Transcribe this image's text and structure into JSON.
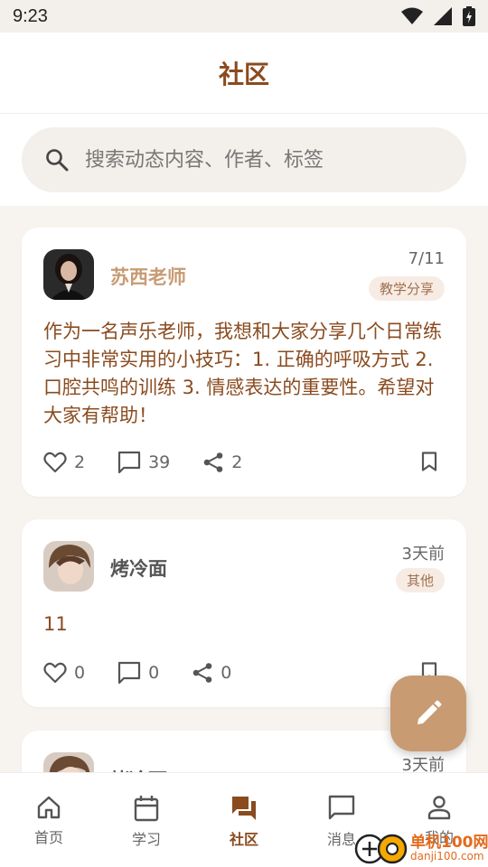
{
  "status_bar": {
    "time": "9:23"
  },
  "header": {
    "title": "社区"
  },
  "search": {
    "placeholder": "搜索动态内容、作者、标签"
  },
  "posts": [
    {
      "author": "苏西老师",
      "author_color": "#c89b73",
      "date": "7/11",
      "tag": "教学分享",
      "content": "作为一名声乐老师，我想和大家分享几个日常练习中非常实用的小技巧：1. 正确的呼吸方式 2. 口腔共鸣的训练 3. 情感表达的重要性。希望对大家有帮助！",
      "likes": "2",
      "comments": "39",
      "shares": "2"
    },
    {
      "author": "烤冷面",
      "author_color": "#555555",
      "date": "3天前",
      "tag": "其他",
      "content": "11",
      "likes": "0",
      "comments": "0",
      "shares": "0"
    },
    {
      "author": "烤冷面",
      "date": "3天前"
    }
  ],
  "nav": [
    {
      "label": "首页",
      "icon": "home-icon"
    },
    {
      "label": "学习",
      "icon": "calendar-icon"
    },
    {
      "label": "社区",
      "icon": "forum-icon",
      "active": true
    },
    {
      "label": "消息",
      "icon": "chat-icon"
    },
    {
      "label": "我的",
      "icon": "person-icon"
    }
  ],
  "watermark": {
    "text1": "单机100网",
    "text2": "danji100.com"
  },
  "colors": {
    "accent": "#c89b73",
    "brown_text": "#8a4b1f",
    "background": "#f7f3ee"
  }
}
